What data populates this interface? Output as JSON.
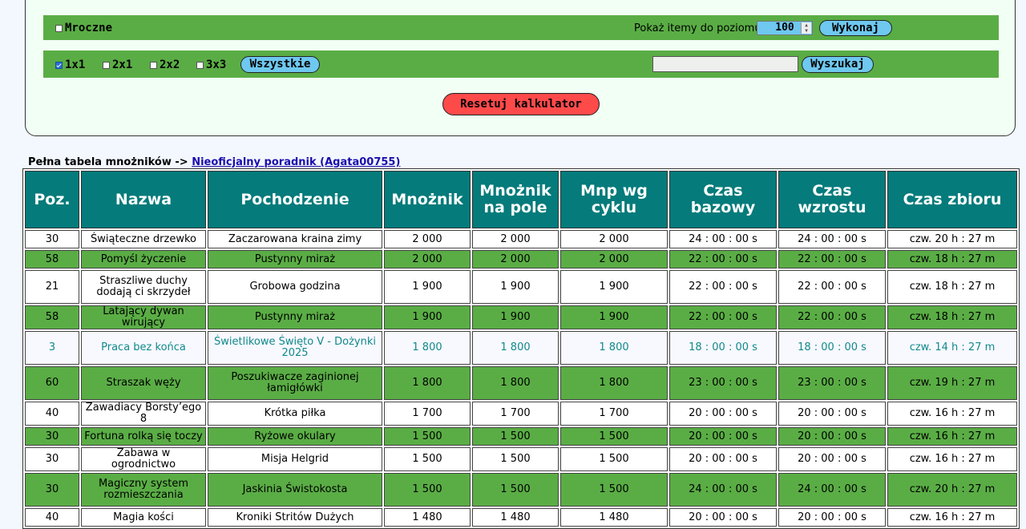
{
  "filters": {
    "dark_label": "Mroczne",
    "show_level_label": "Pokaż itemy do poziomu:",
    "level_value": "100",
    "execute_button": "Wykonaj",
    "sizes": [
      {
        "label": "1x1",
        "checked": true
      },
      {
        "label": "2x1",
        "checked": false
      },
      {
        "label": "2x2",
        "checked": false
      },
      {
        "label": "3x3",
        "checked": false
      }
    ],
    "all_button": "Wszystkie",
    "search_value": "",
    "search_button": "Wyszukaj",
    "reset_button": "Resetuj kalkulator"
  },
  "note": {
    "prefix": "Pełna tabela mnożników ->",
    "link": "Nieoficjalny poradnik (Agata00755)"
  },
  "table": {
    "headers": [
      "Poz.",
      "Nazwa",
      "Pochodzenie",
      "Mnożnik",
      "Mnożnik na pole",
      "Mnp wg cyklu",
      "Czas bazowy",
      "Czas wzrostu",
      "Czas zbioru"
    ],
    "rows": [
      [
        "30",
        "Świąteczne drzewko",
        "Zaczarowana kraina zimy",
        "2 000",
        "2 000",
        "2 000",
        "24 : 00 : 00 s",
        "24 : 00 : 00 s",
        "czw. 20 h : 27 m"
      ],
      [
        "58",
        "Pomyśl życzenie",
        "Pustynny miraż",
        "2 000",
        "2 000",
        "2 000",
        "22 : 00 : 00 s",
        "22 : 00 : 00 s",
        "czw. 18 h : 27 m"
      ],
      [
        "21",
        "Straszliwe duchy dodają ci skrzydeł",
        "Grobowa godzina",
        "1 900",
        "1 900",
        "1 900",
        "22 : 00 : 00 s",
        "22 : 00 : 00 s",
        "czw. 18 h : 27 m"
      ],
      [
        "58",
        "Latający dywan wirujący",
        "Pustynny miraż",
        "1 900",
        "1 900",
        "1 900",
        "22 : 00 : 00 s",
        "22 : 00 : 00 s",
        "czw. 18 h : 27 m"
      ],
      [
        "3",
        "Praca bez końca",
        "Świetlikowe Święto V - Dożynki 2025",
        "1 800",
        "1 800",
        "1 800",
        "18 : 00 : 00 s",
        "18 : 00 : 00 s",
        "czw. 14 h : 27 m"
      ],
      [
        "60",
        "Straszak węży",
        "Poszukiwacze zaginionej łamigłówki",
        "1 800",
        "1 800",
        "1 800",
        "23 : 00 : 00 s",
        "23 : 00 : 00 s",
        "czw. 19 h : 27 m"
      ],
      [
        "40",
        "Zawadiacy Borsty’ego 8",
        "Krótka piłka",
        "1 700",
        "1 700",
        "1 700",
        "20 : 00 : 00 s",
        "20 : 00 : 00 s",
        "czw. 16 h : 27 m"
      ],
      [
        "30",
        "Fortuna rolką się toczy",
        "Ryżowe okulary",
        "1 500",
        "1 500",
        "1 500",
        "20 : 00 : 00 s",
        "20 : 00 : 00 s",
        "czw. 16 h : 27 m"
      ],
      [
        "30",
        "Zabawa w ogrodnictwo",
        "Misja Helgrid",
        "1 500",
        "1 500",
        "1 500",
        "20 : 00 : 00 s",
        "20 : 00 : 00 s",
        "czw. 16 h : 27 m"
      ],
      [
        "30",
        "Magiczny system rozmieszczania",
        "Jaskinia Świstokosta",
        "1 500",
        "1 500",
        "1 500",
        "24 : 00 : 00 s",
        "24 : 00 : 00 s",
        "czw. 20 h : 27 m"
      ],
      [
        "40",
        "Magia kości",
        "Kroniki Stritów Dużych",
        "1 480",
        "1 480",
        "1 480",
        "20 : 00 : 00 s",
        "20 : 00 : 00 s",
        "czw. 16 h : 27 m"
      ]
    ],
    "row_styles": [
      "w",
      "g",
      "w tall",
      "g",
      "w tall hl",
      "g tall",
      "w",
      "g",
      "w",
      "g tall",
      "w"
    ]
  }
}
